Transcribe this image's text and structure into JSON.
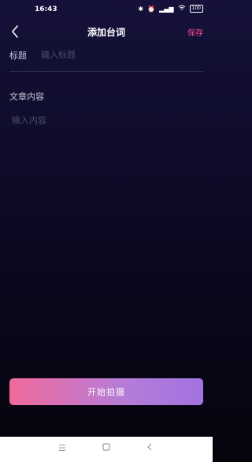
{
  "status_bar": {
    "time": "16:43",
    "battery": "100",
    "icons": [
      "bluetooth-icon",
      "alarm-icon",
      "signal-icon",
      "wifi-icon",
      "battery-icon"
    ]
  },
  "header": {
    "title": "添加台词",
    "save_label": "保存"
  },
  "form": {
    "title_label": "标题",
    "title_placeholder": "输入标题",
    "content_label": "文章内容",
    "content_placeholder": "输入内容"
  },
  "action": {
    "start_label": "开始拍摄"
  },
  "system_nav": {
    "icons": [
      "menu-icon",
      "home-icon",
      "back-icon"
    ]
  },
  "colors": {
    "accent": "#ff4d8b",
    "button_gradient_start": "#f06a9a",
    "button_gradient_end": "#a173e0",
    "background_top": "#15113a",
    "background_bottom": "#05040c"
  }
}
